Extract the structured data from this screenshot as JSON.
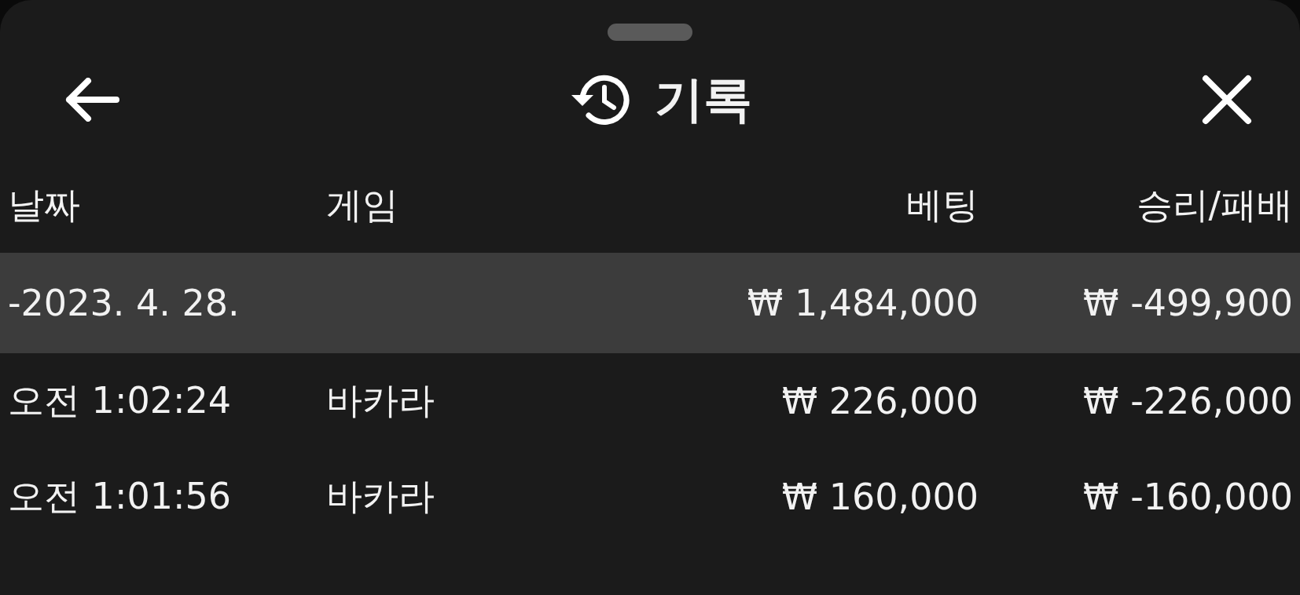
{
  "header": {
    "title": "기록"
  },
  "table": {
    "columns": [
      "날짜",
      "게임",
      "베팅",
      "승리/패배"
    ],
    "rows": [
      {
        "kind": "date",
        "date": "-2023. 4. 28.",
        "bet": "₩ 1,484,000",
        "result": "₩ -499,900"
      },
      {
        "kind": "entry",
        "time": "오전 1:02:24",
        "game": "바카라",
        "bet": "₩ 226,000",
        "result": "₩ -226,000"
      },
      {
        "kind": "entry",
        "time": "오전 1:01:56",
        "game": "바카라",
        "bet": "₩ 160,000",
        "result": "₩ -160,000"
      }
    ]
  }
}
